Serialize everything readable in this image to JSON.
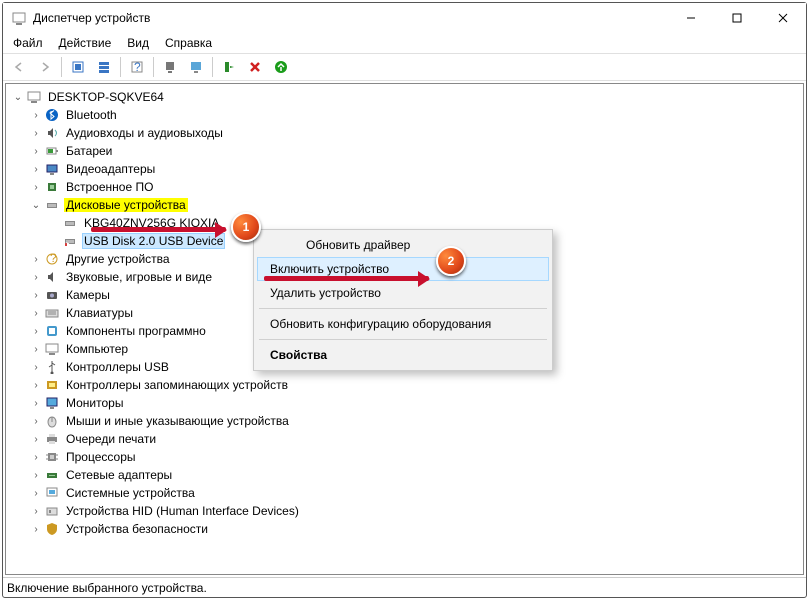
{
  "window": {
    "title": "Диспетчер устройств"
  },
  "menu": {
    "file": "Файл",
    "action": "Действие",
    "view": "Вид",
    "help": "Справка"
  },
  "tree": {
    "root": "DESKTOP-SQKVE64",
    "nodes": [
      "Bluetooth",
      "Аудиовходы и аудиовыходы",
      "Батареи",
      "Видеоадаптеры",
      "Встроенное ПО"
    ],
    "disk_category": "Дисковые устройства",
    "disk_children": [
      "KBG40ZNV256G KIOXIA",
      "USB Disk 2.0 USB Device"
    ],
    "rest": [
      "Другие устройства",
      "Звуковые, игровые и виде",
      "Камеры",
      "Клавиатуры",
      "Компоненты программно",
      "Компьютер",
      "Контроллеры USB",
      "Контроллеры запоминающих устройств",
      "Мониторы",
      "Мыши и иные указывающие устройства",
      "Очереди печати",
      "Процессоры",
      "Сетевые адаптеры",
      "Системные устройства",
      "Устройства HID (Human Interface Devices)",
      "Устройства безопасности"
    ]
  },
  "context_menu": {
    "update_driver": "Обновить драйвер",
    "enable_device": "Включить устройство",
    "uninstall_device": "Удалить устройство",
    "scan_hardware": "Обновить конфигурацию оборудования",
    "properties": "Свойства"
  },
  "status_bar": "Включение выбранного устройства.",
  "badges": {
    "one": "1",
    "two": "2"
  }
}
